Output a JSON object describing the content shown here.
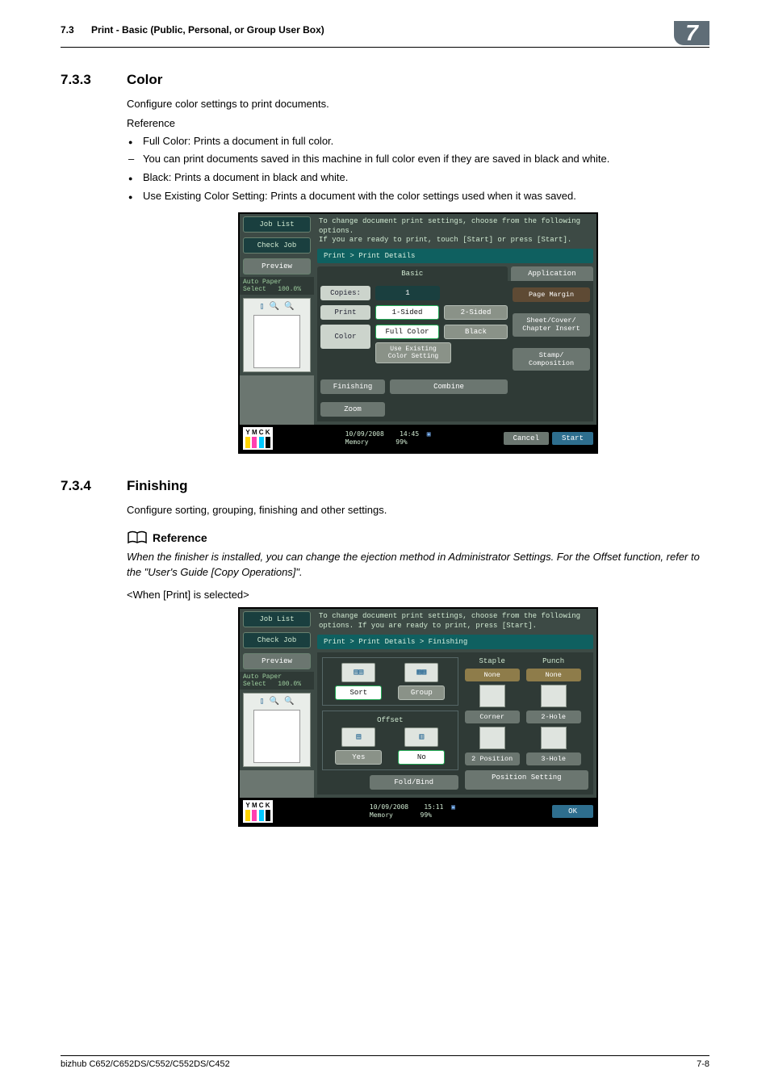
{
  "header": {
    "section_num": "7.3",
    "section_title": "Print - Basic (Public, Personal, or Group User Box)",
    "chapter": "7"
  },
  "s1": {
    "num": "7.3.3",
    "title": "Color",
    "intro": "Configure color settings to print documents.",
    "ref_label": "Reference",
    "bullets": {
      "b1": "Full Color: Prints a document in full color.",
      "b2": "You can print documents saved in this machine in full color even if they are saved in black and white.",
      "b3": "Black: Prints a document in black and white.",
      "b4": "Use Existing Color Setting: Prints a document with the color settings used when it was saved."
    }
  },
  "panel1": {
    "left": {
      "job_list": "Job List",
      "check_job": "Check Job",
      "preview": "Preview",
      "status": "Auto Paper\nSelect   100.0%"
    },
    "msg1": "To change document print settings, choose from the following options.",
    "msg2": "If you are ready to print, touch [Start] or press [Start].",
    "crumb": "Print > Print Details",
    "tabs": {
      "t1": "Basic",
      "t2": "Application"
    },
    "rows": {
      "copies_l": "Copies:",
      "copies_v": "1",
      "print_l": "Print",
      "print_o1": "1-Sided",
      "print_o2": "2-Sided",
      "color_l": "Color",
      "color_o1": "Full Color",
      "color_o2": "Black",
      "color_o3": "Use Existing\nColor Setting"
    },
    "side": {
      "s1": "Page Margin",
      "s2": "Sheet/Cover/\nChapter Insert",
      "s3": "Stamp/\nComposition"
    },
    "lower": {
      "l1": "Finishing",
      "l2": "Combine",
      "l3": "Zoom"
    },
    "foot": {
      "date": "10/09/2008",
      "time": "14:45",
      "mem": "Memory",
      "mem_v": "99%",
      "cancel": "Cancel",
      "start": "Start"
    },
    "toner": {
      "y": "Y",
      "m": "M",
      "c": "C",
      "k": "K"
    }
  },
  "s2": {
    "num": "7.3.4",
    "title": "Finishing",
    "intro": "Configure sorting, grouping, finishing and other settings.",
    "ref_title": "Reference",
    "ref_body": "When the finisher is installed, you can change the ejection method in Administrator Settings. For the Offset function, refer to the \"User's Guide [Copy Operations]\".",
    "caption": "<When [Print] is selected>"
  },
  "panel2": {
    "msg": "To change document print settings, choose from the following options. If you are ready to print, press [Start].",
    "crumb": "Print > Print Details > Finishing",
    "labels": {
      "sort": "Sort",
      "group": "Group",
      "offset": "Offset",
      "yes": "Yes",
      "no": "No",
      "staple": "Staple",
      "punch": "Punch",
      "none": "None",
      "corner": "Corner",
      "two_hole": "2-Hole",
      "two_pos": "2 Position",
      "three_hole": "3-Hole",
      "fold": "Fold/Bind",
      "pos_setting": "Position Setting"
    },
    "foot": {
      "date": "10/09/2008",
      "time": "15:11",
      "mem": "Memory",
      "mem_v": "99%",
      "ok": "OK"
    }
  },
  "footer": {
    "model": "bizhub C652/C652DS/C552/C552DS/C452",
    "page": "7-8"
  }
}
